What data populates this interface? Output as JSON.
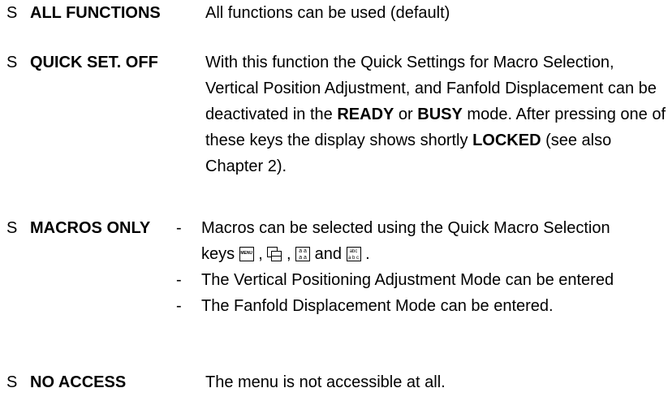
{
  "bullet": "S",
  "entries": [
    {
      "term": "ALL FUNCTIONS",
      "text": "All functions can be used (default)"
    },
    {
      "term": "QUICK SET. OFF",
      "p1": "With this function the Quick Settings for Macro Selection, Vertical Position Adjustment, and Fanfold Displacement can be deactivated in the",
      "b1": "READY",
      "p2": "or",
      "b2": "BUSY",
      "p3": "mode. After pressing one of these keys the display shows shortly",
      "b3": "LOCKED",
      "p4": "(see also Chapter 2)."
    },
    {
      "term": "MACROS ONLY",
      "dash": "-",
      "items": [
        "Macros can be selected using the Quick Macro Selection keys",
        "The Vertical Positioning Adjustment Mode can be entered",
        "The Fanfold Displacement Mode can be entered."
      ],
      "keys": {
        "menu_label": "MENU",
        "aa_top": "a a",
        "aa_bottom": "a a",
        "abc_top": "abc",
        "abc_bottom": "a b c"
      },
      "sep_comma": ",",
      "sep_and": "and",
      "sep_period": "."
    },
    {
      "term": "NO ACCESS",
      "text": "The menu is not accessible at all."
    }
  ]
}
